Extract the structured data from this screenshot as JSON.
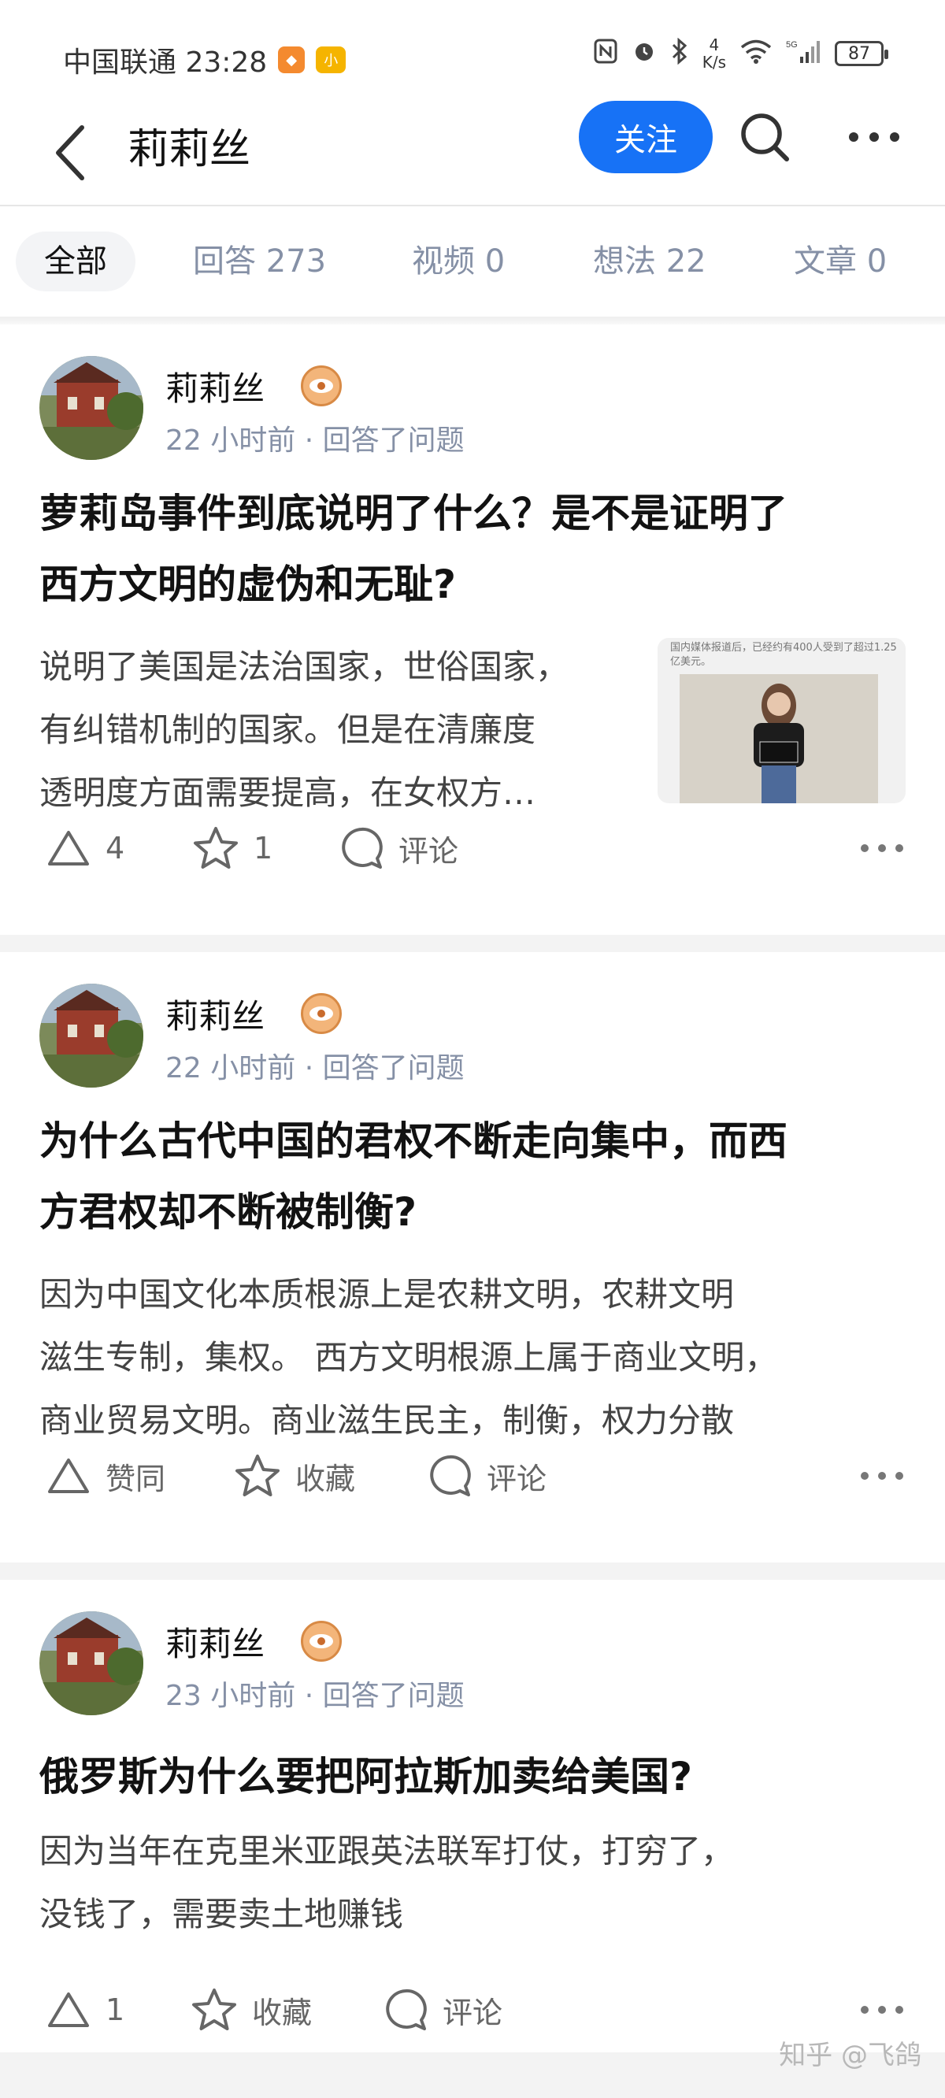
{
  "status_bar": {
    "carrier_time": "中国联通 23:28",
    "badge_a": "◆",
    "badge_b": "小",
    "net_speed_value": "4",
    "net_speed_unit": "K/s",
    "battery": "87"
  },
  "header": {
    "title": "莉莉丝",
    "follow_label": "关注"
  },
  "tabs": [
    {
      "label": "全部"
    },
    {
      "label": "回答 273"
    },
    {
      "label": "视频 0"
    },
    {
      "label": "想法 22"
    },
    {
      "label": "文章 0"
    }
  ],
  "feed": [
    {
      "author": "莉莉丝",
      "meta": "22 小时前 · 回答了问题",
      "title_lines": [
        "萝莉岛事件到底说明了什么？是不是证明了",
        "西方文明的虚伪和无耻?"
      ],
      "excerpt_lines": [
        "说明了美国是法治国家，世俗国家，",
        "有纠错机制的国家。但是在清廉度",
        "透明度方面需要提高，在女权方…"
      ],
      "thumbnail_caption": "国内媒体报道后，已经约有400人受到了超过1.25亿美元。",
      "actions": {
        "upvote": "4",
        "collect": "1",
        "comment": "评论"
      }
    },
    {
      "author": "莉莉丝",
      "meta": "22 小时前 · 回答了问题",
      "title_lines": [
        "为什么古代中国的君权不断走向集中，而西",
        "方君权却不断被制衡?"
      ],
      "excerpt_lines": [
        "因为中国文化本质根源上是农耕文明，农耕文明",
        "滋生专制，集权。 西方文明根源上属于商业文明，",
        "商业贸易文明。商业滋生民主，制衡，权力分散"
      ],
      "actions": {
        "upvote": "赞同",
        "collect": "收藏",
        "comment": "评论"
      }
    },
    {
      "author": "莉莉丝",
      "meta": "23 小时前 · 回答了问题",
      "title_lines": [
        "俄罗斯为什么要把阿拉斯加卖给美国?"
      ],
      "excerpt_lines": [
        "因为当年在克里米亚跟英法联军打仗，打穷了，",
        "没钱了，需要卖土地赚钱"
      ],
      "actions": {
        "upvote": "1",
        "collect": "收藏",
        "comment": "评论"
      }
    }
  ],
  "watermark": "知乎 @飞鸽",
  "colors": {
    "accent": "#1772f6",
    "secondary_text": "#8590a6",
    "badge_orange": "#f3b57a"
  }
}
